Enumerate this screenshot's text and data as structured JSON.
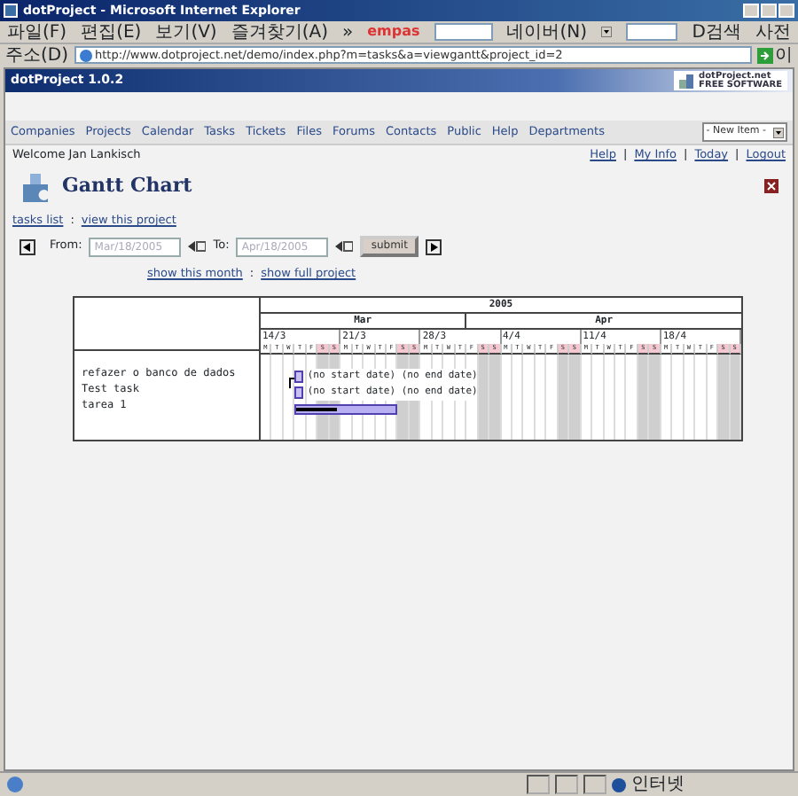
{
  "window": {
    "title": "dotProject - Microsoft Internet Explorer"
  },
  "menu": [
    "파일(F)",
    "편집(E)",
    "보기(V)",
    "즐겨찾기(A)",
    "»"
  ],
  "toolbar": {
    "brand": "empas",
    "search_menu": "네이버(N)",
    "search_button": "D검색",
    "dictionary": "사전"
  },
  "address_bar": {
    "label": "주소(D)",
    "url": "http://www.dotproject.net/demo/index.php?m=tasks&a=viewgantt&project_id=2",
    "go": "이"
  },
  "app_header": {
    "title": "dotProject 1.0.2",
    "logo_title": "dotProject.net",
    "logo_subtitle": "FREE SOFTWARE"
  },
  "nav": [
    "Companies",
    "Projects",
    "Calendar",
    "Tasks",
    "Tickets",
    "Files",
    "Forums",
    "Contacts",
    "Public",
    "Help",
    "Departments"
  ],
  "new_item": {
    "value": "- New Item -"
  },
  "welcome": "Welcome Jan Lankisch",
  "user_links": [
    {
      "kind": "link",
      "text": "Help"
    },
    {
      "kind": "separator",
      "text": "|"
    },
    {
      "kind": "link",
      "text": "My Info"
    },
    {
      "kind": "separator",
      "text": "|"
    },
    {
      "kind": "link",
      "text": "Today"
    },
    {
      "kind": "separator",
      "text": "|"
    },
    {
      "kind": "link",
      "text": "Logout"
    }
  ],
  "page_title": "Gantt Chart",
  "breadcrumbs": [
    {
      "kind": "link",
      "text": "tasks list"
    },
    {
      "kind": "separator",
      "text": ":"
    },
    {
      "kind": "link",
      "text": "view this project"
    }
  ],
  "filter": {
    "from_label": "From:",
    "from": "Mar/18/2005",
    "to_label": "To:",
    "to": "Apr/18/2005",
    "submit": "submit"
  },
  "range_links": [
    {
      "kind": "link",
      "text": "show this month"
    },
    {
      "kind": "separator",
      "text": ":"
    },
    {
      "kind": "link",
      "text": "show full project"
    }
  ],
  "gantt": {
    "year": "2005",
    "months": [
      {
        "label": "Mar"
      },
      {
        "label": "Apr"
      }
    ],
    "weeks": [
      {
        "label": "14/3",
        "days": [
          "M",
          "T",
          "W",
          "T",
          "F",
          "S",
          "S"
        ]
      },
      {
        "label": "21/3",
        "days": [
          "M",
          "T",
          "W",
          "T",
          "F",
          "S",
          "S"
        ]
      },
      {
        "label": "28/3",
        "days": [
          "M",
          "T",
          "W",
          "T",
          "F",
          "S",
          "S"
        ]
      },
      {
        "label": "4/4",
        "days": [
          "M",
          "T",
          "W",
          "T",
          "F",
          "S",
          "S"
        ]
      },
      {
        "label": "11/4",
        "days": [
          "M",
          "T",
          "W",
          "T",
          "F",
          "S",
          "S"
        ]
      },
      {
        "label": "18/4",
        "days": [
          "M",
          "T",
          "W",
          "T",
          "F",
          "S",
          "S"
        ]
      }
    ],
    "tasks": [
      {
        "name": "refazer o banco de dados",
        "kind": "milestone",
        "note": "(no start date) (no end date)",
        "dependency": true
      },
      {
        "name": "Test task",
        "kind": "milestone",
        "note": "(no start date) (no end date)",
        "dependency": false
      },
      {
        "name": "tarea 1",
        "kind": "bar",
        "level": 0.4
      }
    ]
  },
  "status_bar": {
    "zone": "인터넷"
  }
}
